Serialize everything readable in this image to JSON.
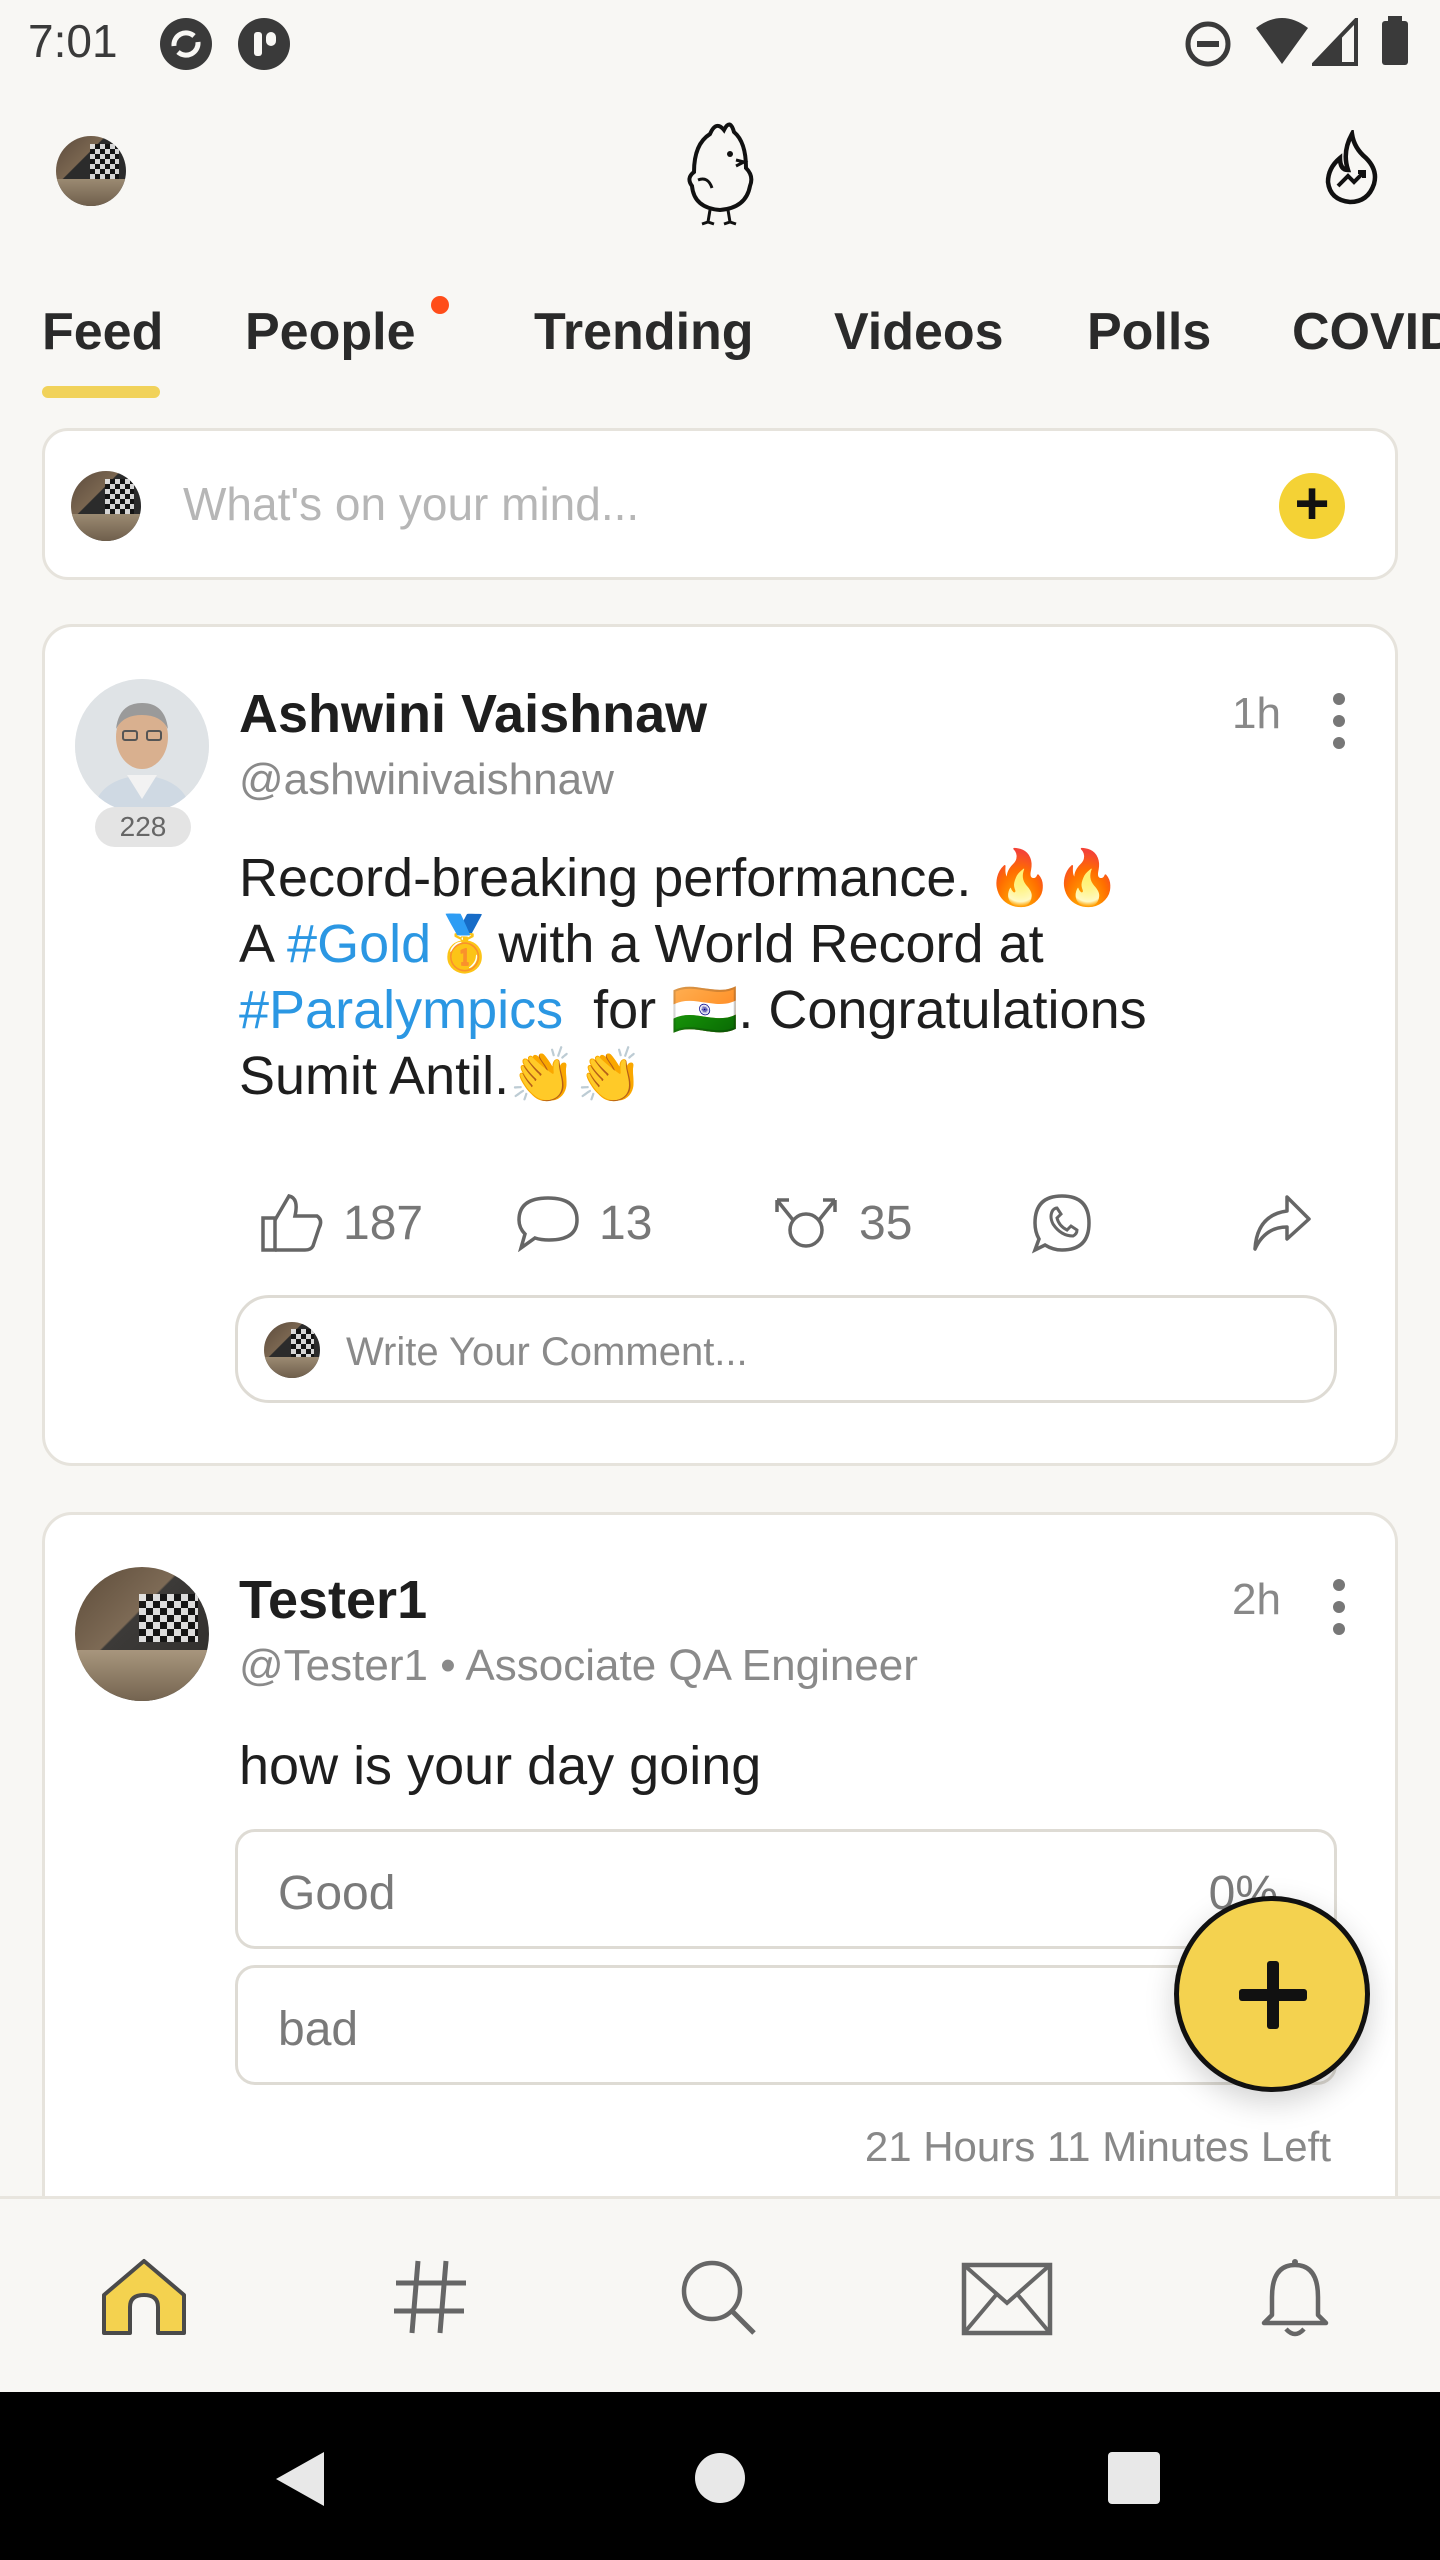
{
  "status_bar": {
    "time": "7:01",
    "icons": [
      "sync-icon",
      "app-icon",
      "dnd-icon",
      "wifi-icon",
      "signal-icon",
      "battery-icon"
    ]
  },
  "header": {
    "logo": "koo-bird-logo",
    "right_icon": "trending-flame-icon"
  },
  "tabs": [
    {
      "label": "Feed",
      "active": true
    },
    {
      "label": "People",
      "has_dot": true
    },
    {
      "label": "Trending"
    },
    {
      "label": "Videos"
    },
    {
      "label": "Polls"
    },
    {
      "label": "COVID"
    }
  ],
  "composer": {
    "placeholder": "What's on your mind...",
    "plus_label": "+"
  },
  "posts": [
    {
      "author": "Ashwini Vaishnaw",
      "handle": "@ashwinivaishnaw",
      "followers_badge": "228",
      "time": "1h",
      "text_line1": "Record-breaking performance. 🔥🔥",
      "text_line2_a": "A ",
      "hashtag1": "#Gold",
      "text_line2_b": "🥇with a World Record at",
      "hashtag2": "#Paralympics",
      "text_line3_b": "  for 🇮🇳. Congratulations",
      "text_line4": "Sumit Antil.👏👏",
      "likes": "187",
      "comments": "13",
      "rekoos": "35",
      "comment_placeholder": "Write Your Comment..."
    },
    {
      "author": "Tester1",
      "handle": "@Tester1",
      "separator": " • ",
      "title": "Associate QA Engineer",
      "time": "2h",
      "text": "how is your day going",
      "poll_options": [
        {
          "label": "Good",
          "percent": "0%"
        },
        {
          "label": "bad",
          "percent": ""
        }
      ],
      "poll_time_left": "21 Hours 11 Minutes Left"
    }
  ],
  "bottom_nav": [
    "home-icon",
    "hashtag-icon",
    "search-icon",
    "messages-icon",
    "notifications-icon"
  ],
  "colors": {
    "accent": "#f4d235",
    "hashtag": "#2b97e3",
    "notification_dot": "#ff4d1a"
  }
}
